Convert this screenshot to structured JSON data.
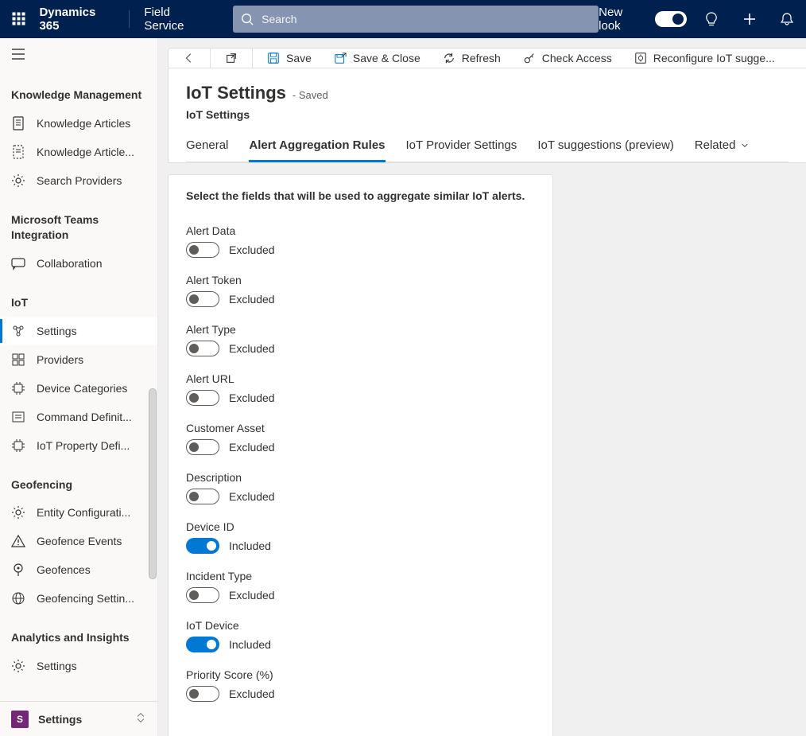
{
  "topbar": {
    "brand": "Dynamics 365",
    "app": "Field Service",
    "search_placeholder": "Search",
    "new_look_label": "New look"
  },
  "sidebar": {
    "groups": [
      {
        "header": "Knowledge Management",
        "items": [
          {
            "id": "knowledge-articles",
            "label": "Knowledge Articles",
            "icon": "doc"
          },
          {
            "id": "knowledge-article-templates",
            "label": "Knowledge Article...",
            "icon": "doc-dashed"
          },
          {
            "id": "search-providers",
            "label": "Search Providers",
            "icon": "gear"
          }
        ]
      },
      {
        "header": "Microsoft Teams Integration",
        "items": [
          {
            "id": "collaboration",
            "label": "Collaboration",
            "icon": "chat"
          }
        ]
      },
      {
        "header": "IoT",
        "items": [
          {
            "id": "settings",
            "label": "Settings",
            "icon": "iot-settings",
            "active": true
          },
          {
            "id": "providers",
            "label": "Providers",
            "icon": "grid"
          },
          {
            "id": "device-categories",
            "label": "Device Categories",
            "icon": "chip"
          },
          {
            "id": "command-definitions",
            "label": "Command Definit...",
            "icon": "list"
          },
          {
            "id": "iot-property-definitions",
            "label": "IoT Property Defi...",
            "icon": "chip"
          }
        ]
      },
      {
        "header": "Geofencing",
        "items": [
          {
            "id": "entity-configurations",
            "label": "Entity Configurati...",
            "icon": "gear"
          },
          {
            "id": "geofence-events",
            "label": "Geofence Events",
            "icon": "alert"
          },
          {
            "id": "geofences",
            "label": "Geofences",
            "icon": "pin"
          },
          {
            "id": "geofencing-settings",
            "label": "Geofencing Settin...",
            "icon": "globe-gear"
          }
        ]
      },
      {
        "header": "Analytics and Insights",
        "items": [
          {
            "id": "analytics-settings",
            "label": "Settings",
            "icon": "gear"
          }
        ]
      }
    ],
    "sitemap": {
      "tile_letter": "S",
      "label": "Settings"
    }
  },
  "commandbar": {
    "save": "Save",
    "save_close": "Save & Close",
    "refresh": "Refresh",
    "check_access": "Check Access",
    "reconfigure": "Reconfigure IoT sugge..."
  },
  "page": {
    "title": "IoT Settings",
    "saved_suffix": "- Saved",
    "subtitle": "IoT Settings",
    "tabs": [
      {
        "id": "general",
        "label": "General"
      },
      {
        "id": "alert-aggregation-rules",
        "label": "Alert Aggregation Rules",
        "active": true
      },
      {
        "id": "iot-provider-settings",
        "label": "IoT Provider Settings"
      },
      {
        "id": "iot-suggestions-preview",
        "label": "IoT suggestions (preview)"
      },
      {
        "id": "related",
        "label": "Related",
        "dropdown": true
      }
    ]
  },
  "form": {
    "instruction": "Select the fields that will be used to aggregate similar IoT alerts.",
    "state_on": "Included",
    "state_off": "Excluded",
    "fields": [
      {
        "label": "Alert Data",
        "on": false
      },
      {
        "label": "Alert Token",
        "on": false
      },
      {
        "label": "Alert Type",
        "on": false
      },
      {
        "label": "Alert URL",
        "on": false
      },
      {
        "label": "Customer Asset",
        "on": false
      },
      {
        "label": "Description",
        "on": false
      },
      {
        "label": "Device ID",
        "on": true
      },
      {
        "label": "Incident Type",
        "on": false
      },
      {
        "label": "IoT Device",
        "on": true
      },
      {
        "label": "Priority Score (%)",
        "on": false
      }
    ]
  }
}
